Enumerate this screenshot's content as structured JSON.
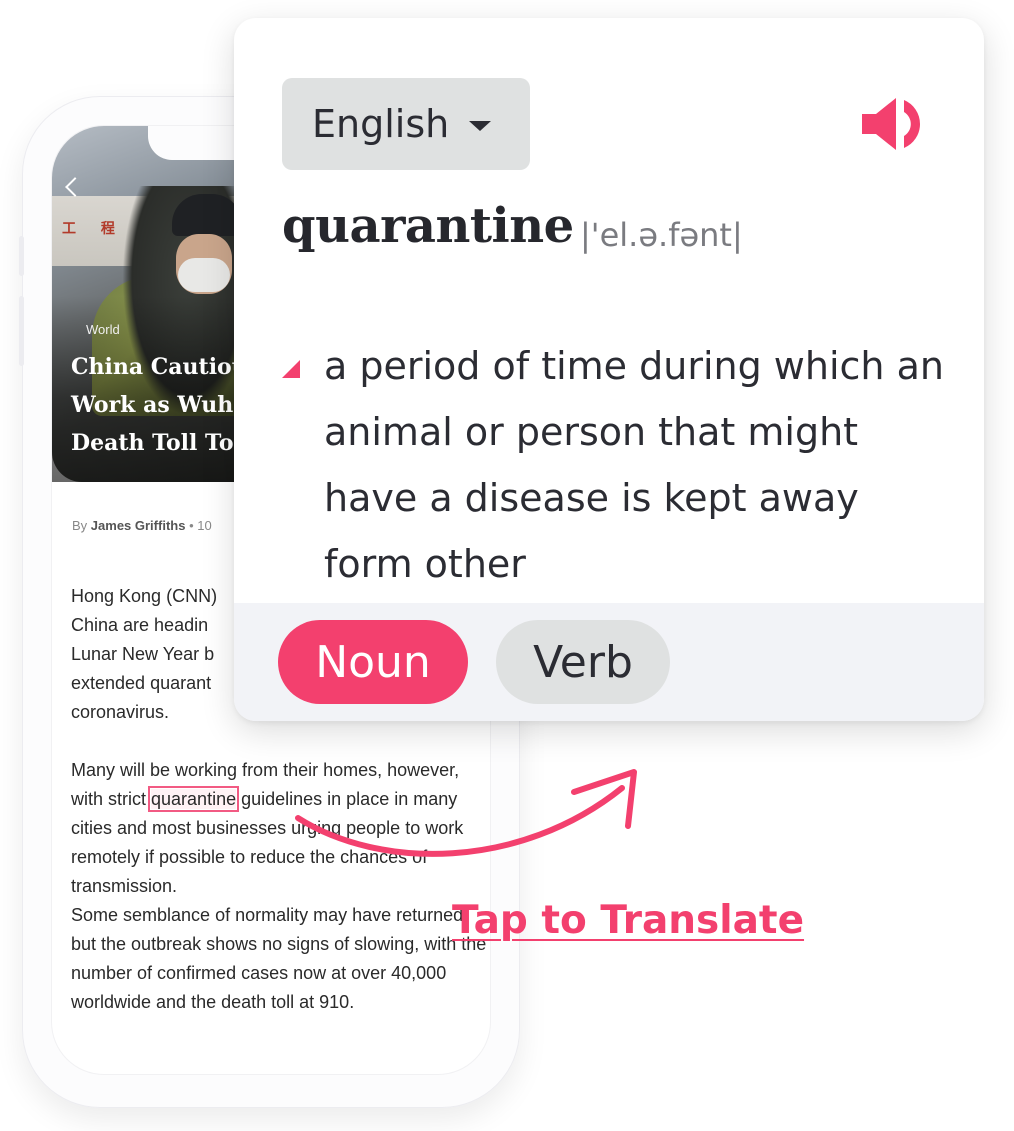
{
  "article": {
    "category": "World",
    "title_lines": [
      "China Cautiou",
      "Work as Wuha",
      "Death Toll Top"
    ],
    "byline_prefix": "By",
    "author": "James Griffiths",
    "byline_suffix": "• 10",
    "paragraph1_lines": [
      "Hong Kong (CNN)",
      "China are headin",
      "Lunar New Year b",
      "extended quarant",
      "coronavirus."
    ],
    "paragraph2_before": "Many will be working from their homes, however, with strict ",
    "highlight_word": "quarantine",
    "paragraph2_after": " guidelines in place in many cities and most businesses urging people to work remotely if possible to reduce the chances of transmission.",
    "paragraph3": "Some semblance of normality may have returned, but the outbreak shows no signs of slowing, with the number of confirmed cases now at over 40,000 worldwide and the death toll at 910."
  },
  "dictionary": {
    "language": "English",
    "word": "quarantine",
    "phonetic": "|'el.ə.fənt|",
    "definition": "a period of time during which an animal or person that might have a disease is kept away form other",
    "parts_of_speech": [
      "Noun",
      "Verb"
    ],
    "selected_part_of_speech": "Noun"
  },
  "cta": {
    "label": "Tap to Translate"
  },
  "colors": {
    "accent": "#f3406e",
    "chip_bg": "#dfe1e1",
    "text_dark": "#2b2c33"
  },
  "icons": [
    "back-arrow-icon",
    "caret-down-icon",
    "speaker-icon",
    "curved-arrow-icon"
  ]
}
